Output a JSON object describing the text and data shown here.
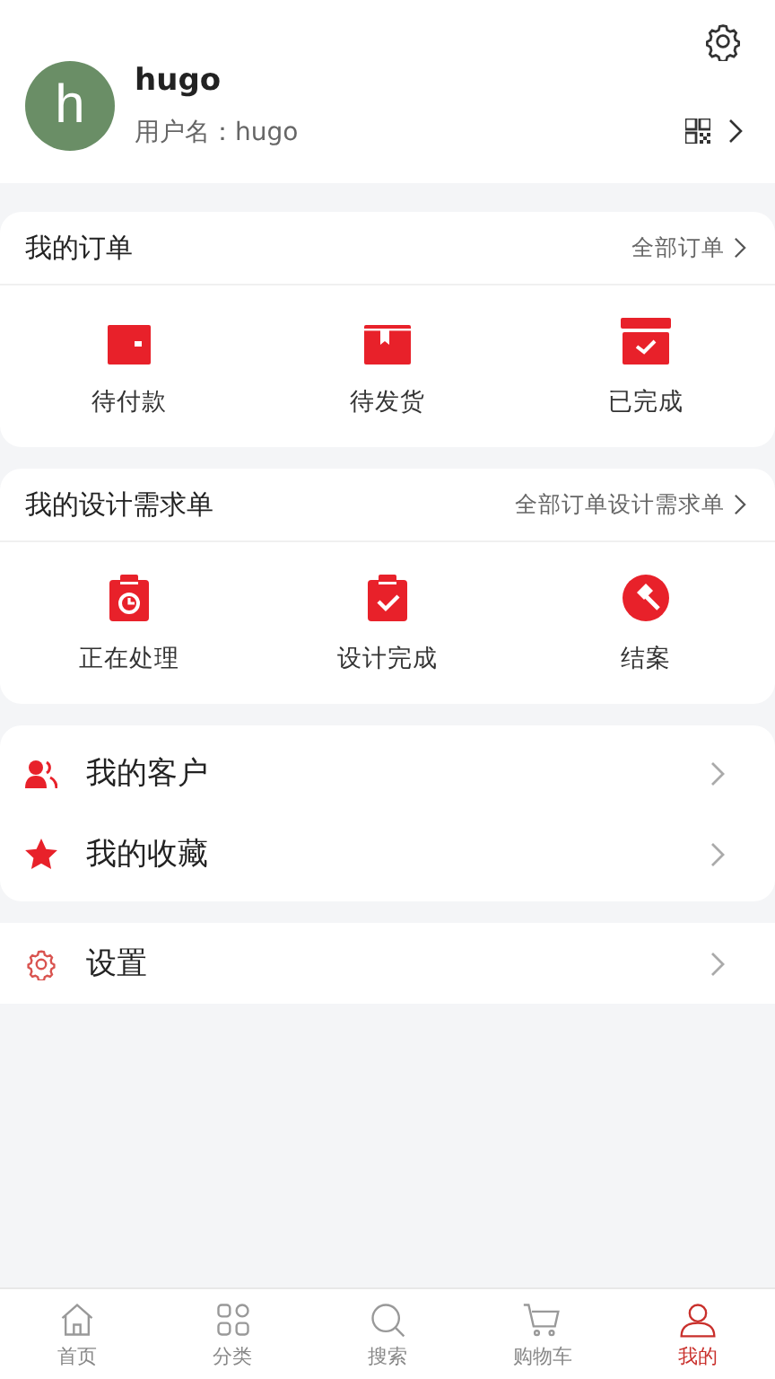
{
  "profile": {
    "avatar_letter": "h",
    "name": "hugo",
    "username": "用户名：hugo"
  },
  "orders": {
    "title": "我的订单",
    "more": "全部订单",
    "items": [
      {
        "label": "待付款"
      },
      {
        "label": "待发货"
      },
      {
        "label": "已完成"
      }
    ]
  },
  "design_requests": {
    "title": "我的设计需求单",
    "more": "全部订单设计需求单",
    "items": [
      {
        "label": "正在处理"
      },
      {
        "label": "设计完成"
      },
      {
        "label": "结案"
      }
    ]
  },
  "menu": [
    {
      "label": "我的客户"
    },
    {
      "label": "我的收藏"
    }
  ],
  "settings": {
    "label": "设置"
  },
  "tab_bar": [
    {
      "label": "首页",
      "selected": false
    },
    {
      "label": "分类",
      "selected": false
    },
    {
      "label": "搜索",
      "selected": false
    },
    {
      "label": "购物车",
      "selected": false
    },
    {
      "label": "我的",
      "selected": true
    }
  ]
}
